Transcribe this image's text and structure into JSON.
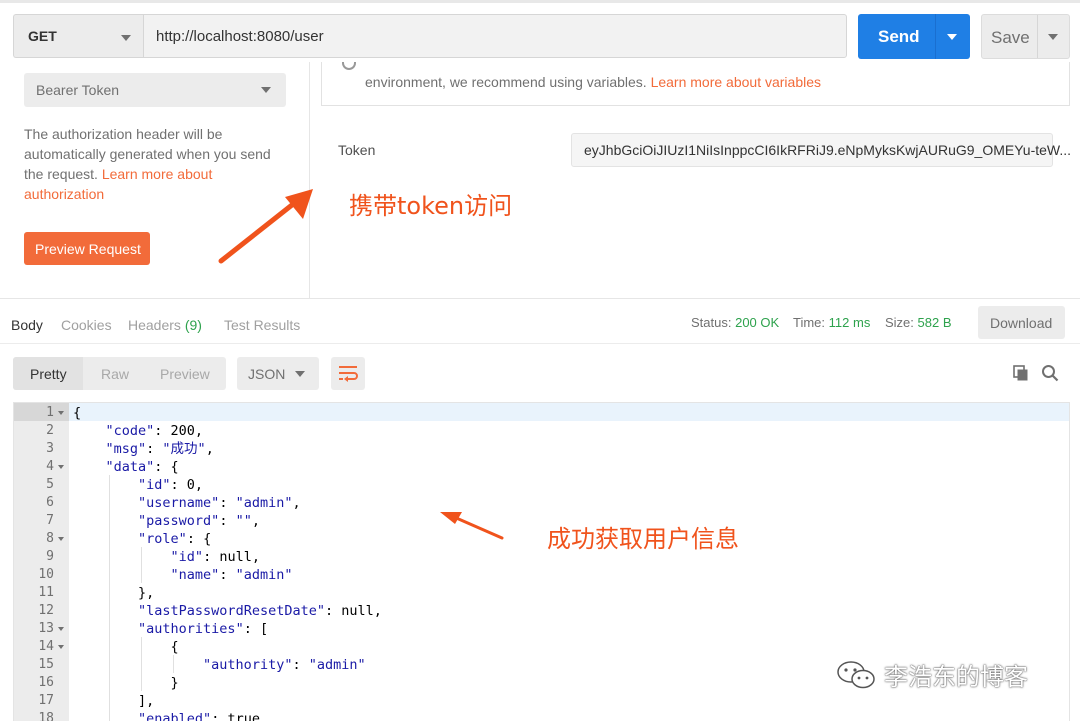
{
  "request": {
    "method": "GET",
    "url": "http://localhost:8080/user",
    "send_label": "Send",
    "save_label": "Save"
  },
  "auth": {
    "type": "Bearer Token",
    "description_prefix": "The authorization header will be automatically generated when you send the request. ",
    "description_link": "Learn more about authorization",
    "preview_label": "Preview Request",
    "info_text": "environment, we recommend using variables. ",
    "info_link": "Learn more about variables",
    "token_label": "Token",
    "token_value": "eyJhbGciOiJIUzI1NiIsInppcCI6IkRFRiJ9.eNpMyksKwjAURuG9_OMEYu-teW..."
  },
  "annotations": {
    "token_note": "携带token访问",
    "result_note": "成功获取用户信息"
  },
  "response": {
    "tabs": [
      {
        "label": "Body"
      },
      {
        "label": "Cookies"
      },
      {
        "label": "Headers",
        "count": "(9)"
      },
      {
        "label": "Test Results"
      }
    ],
    "status_label": "Status:",
    "status_value": "200 OK",
    "time_label": "Time:",
    "time_value": "112 ms",
    "size_label": "Size:",
    "size_value": "582 B",
    "download_label": "Download",
    "formats": [
      "Pretty",
      "Raw",
      "Preview"
    ],
    "content_type": "JSON"
  },
  "code_lines": [
    {
      "n": "1",
      "fold": true,
      "text": "{"
    },
    {
      "n": "2",
      "fold": false,
      "text": "    \"code\": 200,"
    },
    {
      "n": "3",
      "fold": false,
      "text": "    \"msg\": \"成功\","
    },
    {
      "n": "4",
      "fold": true,
      "text": "    \"data\": {"
    },
    {
      "n": "5",
      "fold": false,
      "text": "        \"id\": 0,"
    },
    {
      "n": "6",
      "fold": false,
      "text": "        \"username\": \"admin\","
    },
    {
      "n": "7",
      "fold": false,
      "text": "        \"password\": \"\","
    },
    {
      "n": "8",
      "fold": true,
      "text": "        \"role\": {"
    },
    {
      "n": "9",
      "fold": false,
      "text": "            \"id\": null,"
    },
    {
      "n": "10",
      "fold": false,
      "text": "            \"name\": \"admin\""
    },
    {
      "n": "11",
      "fold": false,
      "text": "        },"
    },
    {
      "n": "12",
      "fold": false,
      "text": "        \"lastPasswordResetDate\": null,"
    },
    {
      "n": "13",
      "fold": true,
      "text": "        \"authorities\": ["
    },
    {
      "n": "14",
      "fold": true,
      "text": "            {"
    },
    {
      "n": "15",
      "fold": false,
      "text": "                \"authority\": \"admin\""
    },
    {
      "n": "16",
      "fold": false,
      "text": "            }"
    },
    {
      "n": "17",
      "fold": false,
      "text": "        ],"
    },
    {
      "n": "18",
      "fold": false,
      "text": "        \"enabled\": true,"
    }
  ],
  "watermark": "李浩东的博客",
  "colors": {
    "accent": "#f26b3a",
    "send": "#1f7fe5",
    "success": "#2ea24d",
    "annotation": "#f0531c"
  }
}
